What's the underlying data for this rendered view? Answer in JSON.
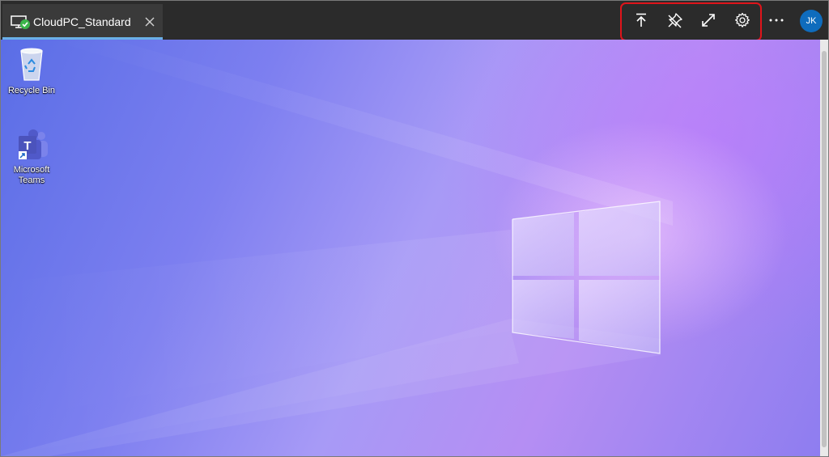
{
  "window": {
    "tab_title": "CloudPC_Standard",
    "tab_icon": "cloud-pc-connected-icon",
    "accent_color": "#6ab0e8"
  },
  "toolbar": {
    "highlight_color": "#e0141b",
    "buttons": [
      {
        "icon": "upload-arrow-icon"
      },
      {
        "icon": "unpin-icon"
      },
      {
        "icon": "expand-diagonal-icon"
      },
      {
        "icon": "gear-icon"
      }
    ],
    "more_icon": "more-horizontal-icon"
  },
  "user": {
    "initials": "JK",
    "avatar_color": "#0f6cbd"
  },
  "desktop": {
    "icons": [
      {
        "label": "Recycle Bin",
        "icon": "recycle-bin-icon"
      },
      {
        "label": "Microsoft Teams",
        "icon": "teams-icon"
      }
    ]
  }
}
